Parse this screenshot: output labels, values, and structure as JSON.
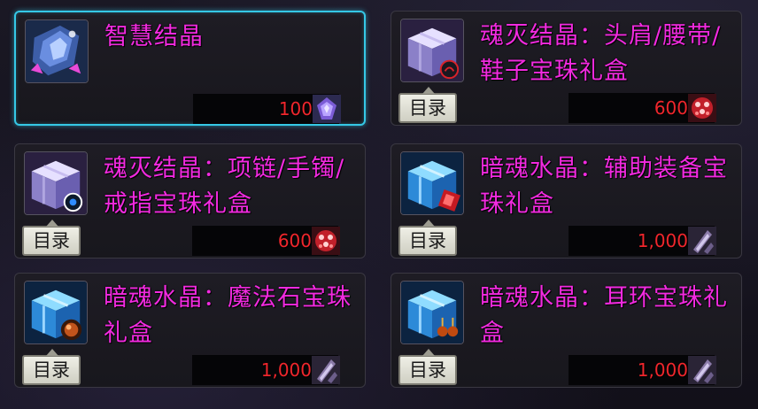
{
  "catalog_label": "目录",
  "items": [
    {
      "name": "智慧结晶",
      "price": "100",
      "currency_icon": "crystal-currency-icon",
      "item_icon": "wisdom-crystal-icon",
      "has_catalog_button": false,
      "selected": true
    },
    {
      "name": "魂灭结晶：头肩/腰带/鞋子宝珠礼盒",
      "price": "600",
      "currency_icon": "soul-gem-currency-icon",
      "item_icon": "gift-box-icon",
      "has_catalog_button": true,
      "selected": false
    },
    {
      "name": "魂灭结晶：项链/手镯/戒指宝珠礼盒",
      "price": "600",
      "currency_icon": "soul-gem-currency-icon",
      "item_icon": "gift-box-icon",
      "has_catalog_button": true,
      "selected": false
    },
    {
      "name": "暗魂水晶：辅助装备宝珠礼盒",
      "price": "1,000",
      "currency_icon": "dark-crystal-currency-icon",
      "item_icon": "blue-gift-box-icon",
      "has_catalog_button": true,
      "selected": false
    },
    {
      "name": "暗魂水晶：魔法石宝珠礼盒",
      "price": "1,000",
      "currency_icon": "dark-crystal-currency-icon",
      "item_icon": "blue-gift-box-icon",
      "has_catalog_button": true,
      "selected": false
    },
    {
      "name": "暗魂水晶：耳环宝珠礼盒",
      "price": "1,000",
      "currency_icon": "dark-crystal-currency-icon",
      "item_icon": "blue-gift-box-icon",
      "has_catalog_button": true,
      "selected": false
    }
  ],
  "colors": {
    "name_text": "#f22ae0",
    "price_text": "#f0262c",
    "selection_border": "#35c8e6"
  }
}
